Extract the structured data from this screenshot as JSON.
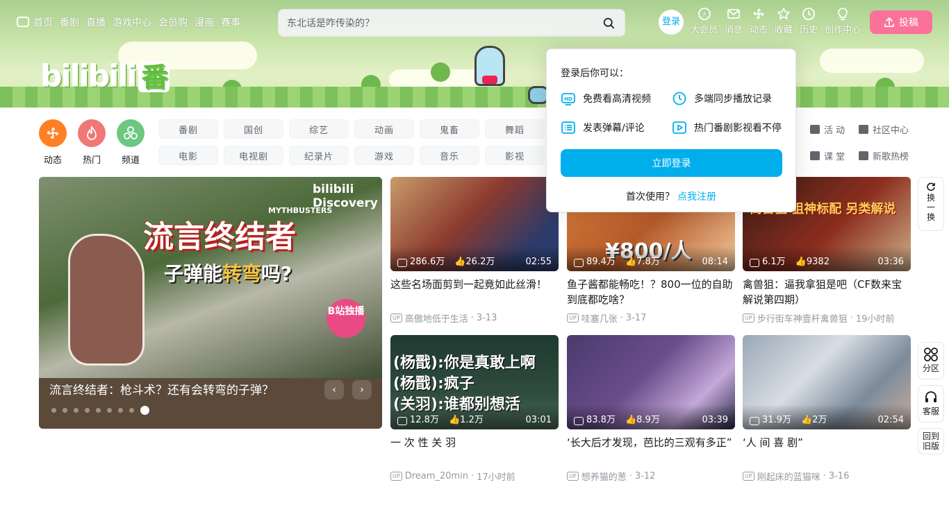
{
  "nav": {
    "left": [
      "首页",
      "番剧",
      "直播",
      "游戏中心",
      "会员购",
      "漫画",
      "赛事"
    ],
    "search_placeholder": "东北话是咋传染的？",
    "login_label": "登录",
    "right": [
      {
        "label": "大会员",
        "icon": "vip-icon"
      },
      {
        "label": "消息",
        "icon": "message-icon"
      },
      {
        "label": "动态",
        "icon": "dynamic-icon"
      },
      {
        "label": "收藏",
        "icon": "favorite-icon"
      },
      {
        "label": "历史",
        "icon": "history-icon"
      },
      {
        "label": "创作中心",
        "icon": "creator-icon"
      }
    ],
    "upload_label": "投稿"
  },
  "channels": {
    "round": [
      {
        "label": "动态",
        "color": "#ff7f24"
      },
      {
        "label": "热门",
        "color": "#f07775"
      },
      {
        "label": "频道",
        "color": "#6dc781"
      }
    ],
    "tags": [
      "番剧",
      "国创",
      "综艺",
      "动画",
      "鬼畜",
      "舞蹈",
      "电影",
      "电视剧",
      "纪录片",
      "游戏",
      "音乐",
      "影视"
    ],
    "side": [
      "活 动",
      "社区中心",
      "课 堂",
      "新歌热榜"
    ]
  },
  "carousel": {
    "title": "流言终结者：枪斗术？还有会转弯的子弹？",
    "big_text": "流言终结者",
    "sub_text_a": "子弹能",
    "sub_text_b": "转弯",
    "sub_text_c": "吗?",
    "discovery": "bilibili  Discovery",
    "mythbusters": "MYTHBUSTERS",
    "stamp": "B站独播",
    "dots": 9,
    "active_dot": 8
  },
  "cards": [
    {
      "views": "286.6万",
      "likes": "26.2万",
      "duration": "02:55",
      "title": "这些名场面剪到一起竟如此丝滑！",
      "author": "高傲地低于生活",
      "date": "3-13",
      "color": "#8b3a2e"
    },
    {
      "views": "89.4万",
      "likes": "7.8万",
      "duration": "08:14",
      "title": "鱼子酱都能畅吃！？800一位的自助到底都吃啥？",
      "author": "哇塞几张",
      "date": "3-17",
      "color": "#c9703c",
      "overlay": "¥800/人"
    },
    {
      "views": "6.1万",
      "likes": "9382",
      "duration": "03:36",
      "title": "禽兽狙：逼我拿狙是吧（CF数来宝解说第四期）",
      "author": "步行街车神壹杆禽兽狙",
      "date": "19小时前",
      "color": "#6c2a1f",
      "overlay": "禽兽狙 狙神标配 另类解说"
    },
    {
      "views": "12.8万",
      "likes": "1.2万",
      "duration": "03:01",
      "title": "一 次 性 关 羽",
      "author": "Dream_20min",
      "date": "17小时前",
      "color": "#2e4b3e",
      "overlay": "(杨戬):你是真敢上啊\n(杨戬):疯子\n(关羽):谁都别想活"
    },
    {
      "views": "83.8万",
      "likes": "8.9万",
      "duration": "03:39",
      "title": "‘长大后才发现，芭比的三观有多正”",
      "author": "想养猫的葱",
      "date": "3-12",
      "color": "#6a4d8c"
    },
    {
      "views": "31.9万",
      "likes": "2万",
      "duration": "02:54",
      "title": "‘人 间 喜 剧”",
      "author": "刚起床的蓝猫咪",
      "date": "3-16",
      "color": "#7c8a9a"
    }
  ],
  "float": {
    "refresh": "换一换",
    "zone": "分区",
    "service": "客服",
    "old": "回到旧版"
  },
  "popover": {
    "title": "登录后你可以：",
    "items": [
      "免费看高清视频",
      "多端同步播放记录",
      "发表弹幕/评论",
      "热门番剧影视看不停"
    ],
    "button": "立即登录",
    "foot_text": "首次使用？",
    "foot_link": "点我注册"
  }
}
